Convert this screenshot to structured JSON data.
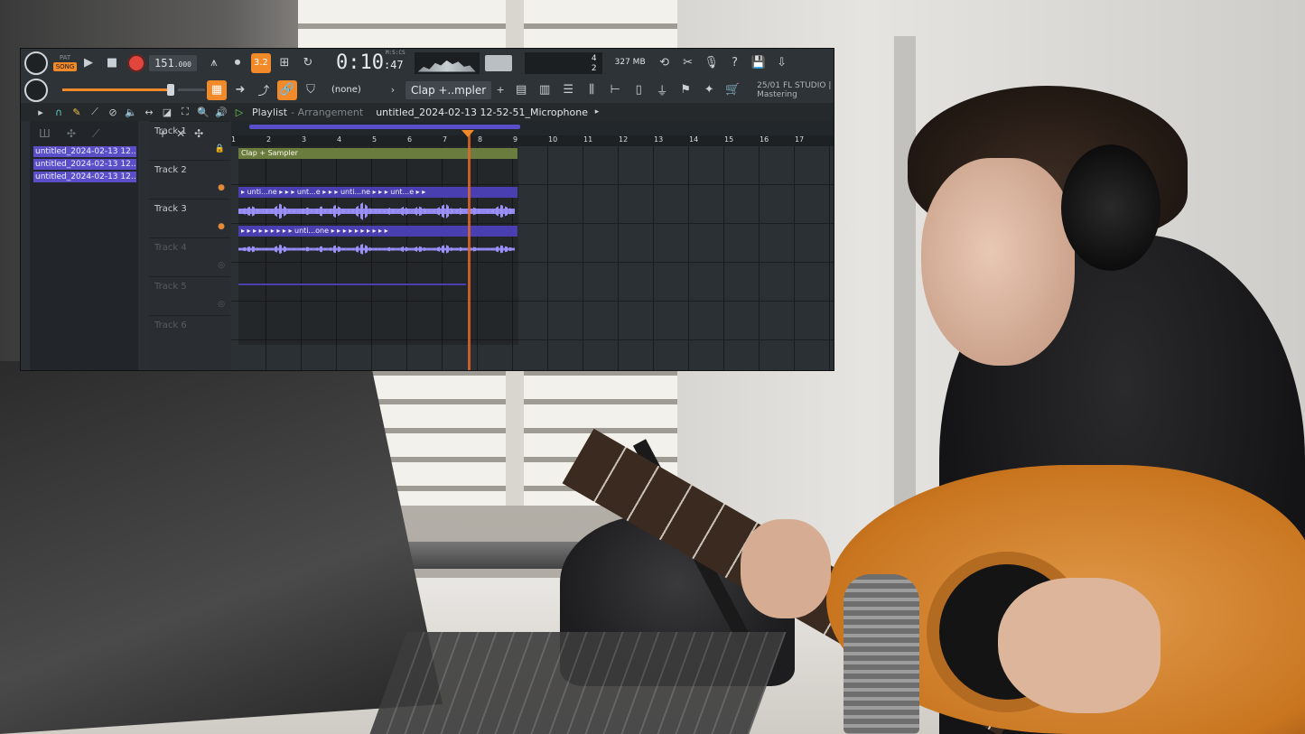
{
  "toolbar": {
    "pat_label": "PAT",
    "song_label": "SONG",
    "tempo": "151",
    "tempo_decimals": ".000",
    "snap_label": "3.2",
    "time_main": "0:10",
    "time_sub": ":47",
    "time_format": "M:S:CS",
    "cpu_value": "4",
    "mem_value": "327 MB",
    "poly_value": "2",
    "none_label": "(none)",
    "channel_label": "Clap +..mpler",
    "version_line1": "25/01 FL STUDIO |",
    "version_line2": "Mastering"
  },
  "playlist": {
    "title": "Playlist",
    "separator": " - ",
    "mode": "Arrangement",
    "pattern_name": "untitled_2024-02-13 12-52-51_Microphone"
  },
  "browser": {
    "items": [
      "untitled_2024-02-13 12...",
      "untitled_2024-02-13 12...",
      "untitled_2024-02-13 12..."
    ]
  },
  "ruler": [
    "1",
    "2",
    "3",
    "4",
    "5",
    "6",
    "7",
    "8",
    "9",
    "10",
    "11",
    "12",
    "13",
    "14",
    "15",
    "16",
    "17"
  ],
  "tracks": [
    {
      "name": "Track 1"
    },
    {
      "name": "Track 2"
    },
    {
      "name": "Track 3"
    },
    {
      "name": "Track 4"
    },
    {
      "name": "Track 5"
    },
    {
      "name": "Track 6"
    }
  ],
  "clips": {
    "track1": "Clap + Sampler",
    "track2": "▸ unti...ne ▸ ▸ ▸ unt...e ▸ ▸ ▸ unti...ne ▸ ▸ ▸ unt...e ▸ ▸",
    "track3": "▸ ▸ ▸ ▸ ▸ ▸ ▸ ▸ ▸ unti...one ▸ ▸ ▸ ▸ ▸ ▸ ▸ ▸ ▸ ▸"
  },
  "colors": {
    "accent": "#f28a2a",
    "clip_purple": "#4a3fb0",
    "clip_green": "#6b7d3e",
    "record": "#e2453c"
  }
}
